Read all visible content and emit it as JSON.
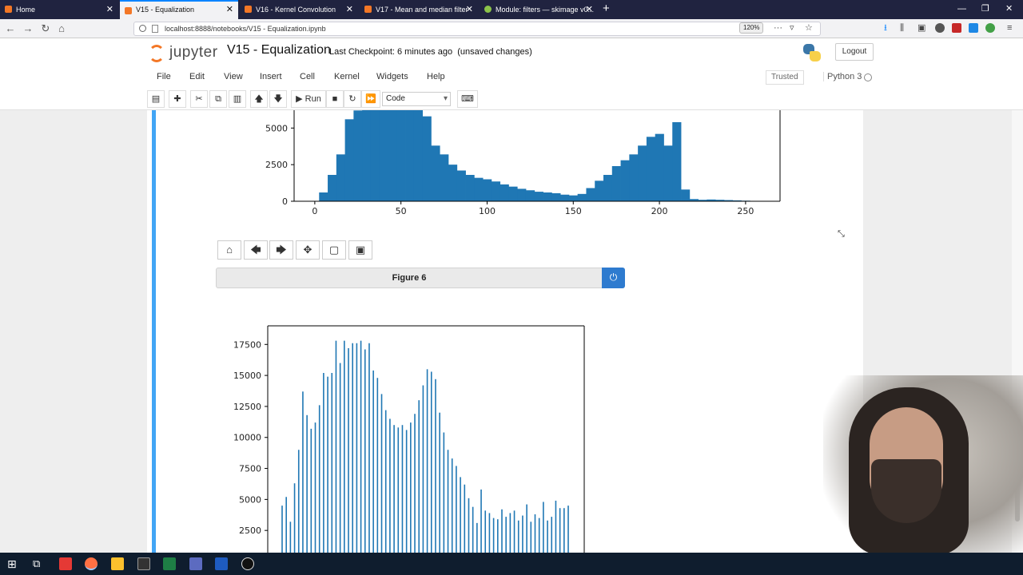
{
  "browser": {
    "tabs": [
      {
        "title": "Home",
        "active": false
      },
      {
        "title": "V15 - Equalization",
        "active": true
      },
      {
        "title": "V16 - Kernel Convolution",
        "active": false
      },
      {
        "title": "V17 - Mean and median filter",
        "active": false
      },
      {
        "title": "Module: filters — skimage v0...",
        "active": false
      }
    ],
    "new_tab": "+",
    "url": "localhost:8888/notebooks/V15 - Equalization.ipynb",
    "zoom": "120%",
    "window_controls": [
      "—",
      "❐",
      "✕"
    ]
  },
  "jupyter": {
    "logo_text": "jupyter",
    "notebook_title": "V15 - Equalization",
    "checkpoint": "Last Checkpoint: 6 minutes ago",
    "unsaved": "(unsaved changes)",
    "logout": "Logout",
    "menus": [
      "File",
      "Edit",
      "View",
      "Insert",
      "Cell",
      "Kernel",
      "Widgets",
      "Help"
    ],
    "trusted": "Trusted",
    "kernel_name": "Python 3",
    "toolbar": {
      "run_label": "Run",
      "cell_type": "Code"
    }
  },
  "figure": {
    "title": "Figure 6",
    "toolbar_icons": [
      "home-icon",
      "back-arrow-icon",
      "forward-arrow-icon",
      "pan-icon",
      "zoom-rect-icon",
      "save-icon"
    ]
  },
  "chart_data": [
    {
      "type": "bar",
      "description_visible": "histogram (top, partially scrolled)",
      "x_ticks": [
        "0",
        "50",
        "100",
        "150",
        "200",
        "250"
      ],
      "y_ticks": [
        "0",
        "2500",
        "5000"
      ],
      "xlim": [
        -12,
        270
      ],
      "ylim": [
        0,
        6000
      ],
      "color": "#1f77b4",
      "x": [
        5,
        10,
        15,
        20,
        25,
        30,
        35,
        40,
        45,
        50,
        55,
        60,
        65,
        70,
        75,
        80,
        85,
        90,
        95,
        100,
        105,
        110,
        115,
        120,
        125,
        130,
        135,
        140,
        145,
        150,
        155,
        160,
        165,
        170,
        175,
        180,
        185,
        190,
        195,
        200,
        205,
        210,
        215,
        220,
        225,
        230,
        235,
        240,
        245,
        250,
        255
      ],
      "values": [
        600,
        1800,
        3200,
        5600,
        6200,
        6400,
        6400,
        6400,
        6400,
        6400,
        6400,
        6400,
        5800,
        3800,
        3200,
        2500,
        2100,
        1800,
        1600,
        1500,
        1350,
        1150,
        1000,
        850,
        750,
        650,
        600,
        550,
        450,
        400,
        500,
        900,
        1400,
        1800,
        2400,
        2800,
        3200,
        3800,
        4400,
        4600,
        3800,
        5400,
        800,
        150,
        100,
        120,
        100,
        80,
        60,
        40,
        20
      ]
    },
    {
      "type": "bar",
      "description_visible": "histogram (bottom, partially scrolled)",
      "y_ticks": [
        "2500",
        "5000",
        "7500",
        "10000",
        "12500",
        "15000",
        "17500"
      ],
      "ylim": [
        0,
        18000
      ],
      "color": "#1f77b4",
      "values": [
        4500,
        5200,
        3200,
        6300,
        9000,
        13700,
        11800,
        10700,
        11200,
        12600,
        15200,
        14900,
        15200,
        17800,
        16000,
        17800,
        17200,
        17600,
        17600,
        17800,
        17100,
        17600,
        15400,
        14800,
        13500,
        12200,
        11500,
        11000,
        10800,
        11000,
        10600,
        11200,
        11900,
        13000,
        14200,
        15500,
        15300,
        14700,
        12000,
        10400,
        9000,
        8300,
        7700,
        6800,
        6200,
        5100,
        4400,
        3100,
        5800,
        4100,
        3900,
        3500,
        3400,
        4200,
        3600,
        3900,
        4100,
        3300,
        3700,
        4600,
        3200,
        3800,
        3500,
        4800,
        3300,
        3600,
        4900,
        4300,
        4300,
        4500
      ]
    }
  ],
  "taskbar": {
    "apps": [
      "windows-start",
      "task-view",
      "antivirus",
      "firefox",
      "file-explorer",
      "terminal",
      "excel",
      "teams",
      "word",
      "obs"
    ]
  }
}
